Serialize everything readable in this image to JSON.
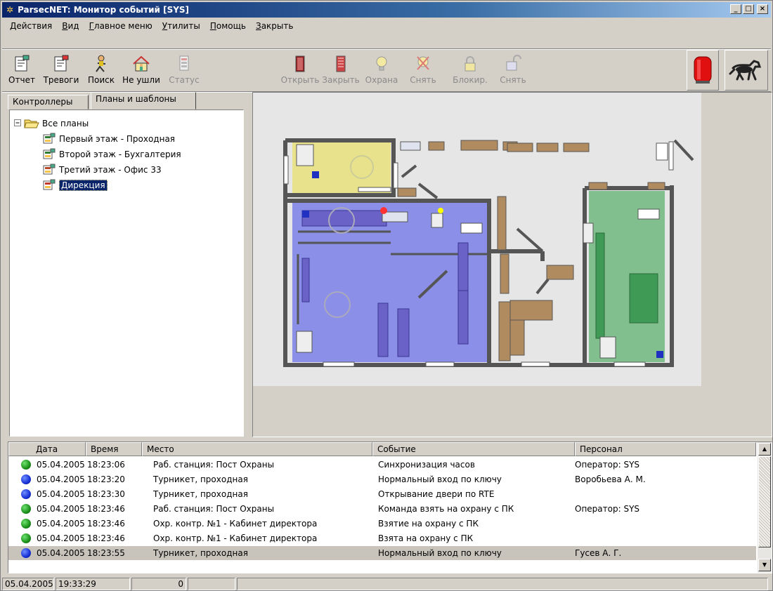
{
  "window": {
    "title": "ParsecNET: Монитор событий [SYS]"
  },
  "menu": [
    {
      "pre": "",
      "ul": "Д",
      "post": "ействия"
    },
    {
      "pre": "",
      "ul": "В",
      "post": "ид"
    },
    {
      "pre": "",
      "ul": "Г",
      "post": "лавное меню"
    },
    {
      "pre": "",
      "ul": "У",
      "post": "тилиты"
    },
    {
      "pre": "",
      "ul": "П",
      "post": "омощь"
    },
    {
      "pre": "",
      "ul": "З",
      "post": "акрыть"
    }
  ],
  "toolbar": {
    "report": "Отчет",
    "alarms": "Тревоги",
    "search": "Поиск",
    "not_left": "Не ушли",
    "status": "Статус",
    "open": "Открыть",
    "close": "Закрыть",
    "arm": "Охрана",
    "disarm": "Снять",
    "block": "Блокир.",
    "unblock": "Снять"
  },
  "tabs": {
    "controllers": "Контроллеры",
    "plans": "Планы и шаблоны"
  },
  "tree": {
    "root": "Все планы",
    "items": [
      "Первый этаж - Проходная",
      "Второй этаж - Бухгалтерия",
      "Третий этаж - Офис 33",
      "Дирекция"
    ],
    "selected_index": 3
  },
  "events": {
    "columns": [
      "Дата",
      "Время",
      "Место",
      "Событие",
      "Персонал"
    ],
    "rows": [
      {
        "status": "green",
        "date": "05.04.2005",
        "time": "18:23:06",
        "place": "Раб. станция: Пост Охраны",
        "event": "Синхронизация часов",
        "staff": "Оператор: SYS"
      },
      {
        "status": "blue",
        "date": "05.04.2005",
        "time": "18:23:20",
        "place": "Турникет, проходная",
        "event": "Нормальный вход по ключу",
        "staff": "Воробьева А. М."
      },
      {
        "status": "blue",
        "date": "05.04.2005",
        "time": "18:23:30",
        "place": "Турникет, проходная",
        "event": "Открывание двери по RTE",
        "staff": ""
      },
      {
        "status": "green",
        "date": "05.04.2005",
        "time": "18:23:46",
        "place": "Раб. станция: Пост Охраны",
        "event": "Команда взять на охрану с ПК",
        "staff": "Оператор: SYS"
      },
      {
        "status": "green",
        "date": "05.04.2005",
        "time": "18:23:46",
        "place": "Охр. контр. №1 - Кабинет директора",
        "event": "Взятие на охрану с ПК",
        "staff": ""
      },
      {
        "status": "green",
        "date": "05.04.2005",
        "time": "18:23:46",
        "place": "Охр. контр. №1 - Кабинет директора",
        "event": "Взята на охрану с ПК",
        "staff": ""
      },
      {
        "status": "blue",
        "date": "05.04.2005",
        "time": "18:23:55",
        "place": "Турникет, проходная",
        "event": "Нормальный вход по ключу",
        "staff": "Гусев А. Г."
      }
    ],
    "selected_index": 6
  },
  "statusbar": {
    "date": "05.04.2005",
    "time": "19:33:29",
    "count": "0"
  },
  "colors": {
    "title_start": "#0a246a",
    "title_end": "#a6caf0",
    "zone_armed_blue": "#7b7fe8",
    "zone_green": "#6fb77f",
    "zone_yellow": "#e6e07a",
    "status_green": "#1a8f1a",
    "status_blue": "#1630d6"
  }
}
